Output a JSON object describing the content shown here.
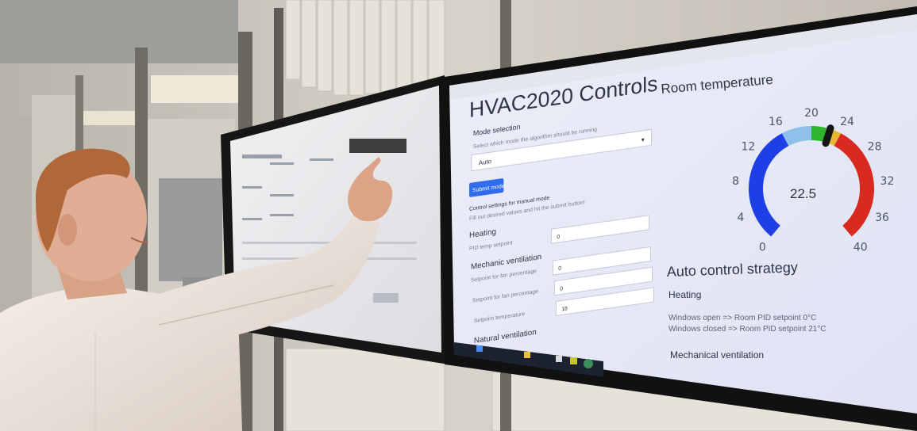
{
  "right_screen": {
    "app_title": "HVAC2020 Controls",
    "mode_section_title": "Mode selection",
    "mode_hint": "Select which mode the algorithm should be running",
    "mode_select_value": "Auto",
    "submit_mode_label": "Submit mode",
    "manual_title": "Control settings for manual mode",
    "manual_hint": "Fill out desired values and hit the submit button!",
    "heating_title": "Heating",
    "pid_label": "PID temp setpoint",
    "pid_value": "0",
    "mech_title": "Mechanic ventilation",
    "supply_fan_label": "Setpoint for fan percentage",
    "supply_fan_value": "0",
    "exhaust_fan_label": "Setpoint for fan percentage",
    "exhaust_fan_value": "0",
    "supply_temp_label": "Setpoint temperature",
    "supply_temp_value": "18",
    "natural_title": "Natural ventilation",
    "room_temp_title": "Room temperature",
    "gauge": {
      "value": "22.5",
      "ticks": [
        "0",
        "4",
        "8",
        "12",
        "16",
        "20",
        "24",
        "28",
        "32",
        "36",
        "40"
      ],
      "colors": {
        "cold": "#1f3fe6",
        "cool": "#8fc0ea",
        "comfort": "#2db52d",
        "warm": "#e6b832",
        "hot": "#d92a22",
        "needle": "#151515"
      }
    },
    "auto_title": "Auto control strategy",
    "auto_heating_title": "Heating",
    "auto_line1": "Windows open => Room PID setpoint 0°C",
    "auto_line2": "Windows closed => Room PID setpoint 21°C",
    "auto_mech_title": "Mechanical ventilation"
  }
}
